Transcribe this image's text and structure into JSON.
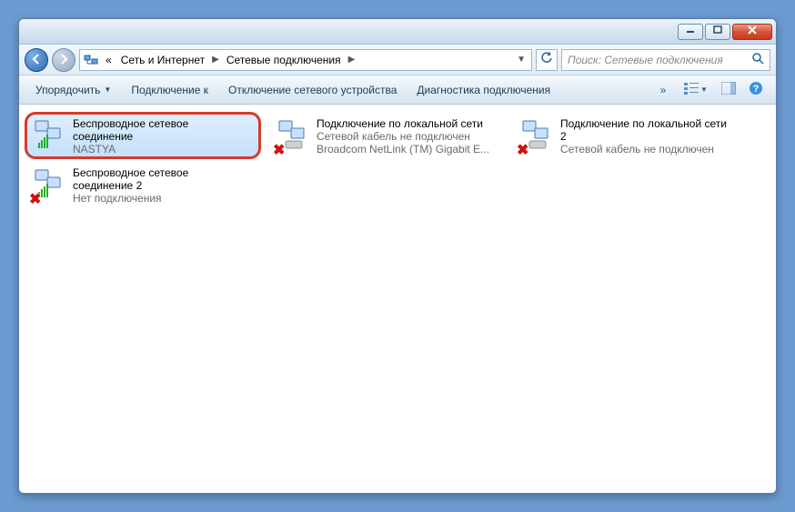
{
  "titlebar": {
    "min_icon": "minimize-icon",
    "max_icon": "maximize-icon",
    "close_icon": "close-icon"
  },
  "nav": {
    "back_icon": "back-arrow-icon",
    "forward_icon": "forward-arrow-icon",
    "refresh_icon": "refresh-icon"
  },
  "breadcrumb": {
    "prefix": "«",
    "seg1": "Сеть и Интернет",
    "seg2": "Сетевые подключения"
  },
  "search": {
    "placeholder": "Поиск: Сетевые подключения",
    "icon": "search-icon"
  },
  "toolbar": {
    "organize": "Упорядочить",
    "connect_to": "Подключение к",
    "disable_device": "Отключение сетевого устройства",
    "diagnose": "Диагностика подключения",
    "more_icon": "chevron-right-icon",
    "view_icon": "view-options-icon",
    "preview_icon": "preview-pane-icon",
    "help_icon": "help-icon"
  },
  "connections": [
    {
      "title": "Беспроводное сетевое",
      "title2": "соединение",
      "status": "NASTYA",
      "detail": "",
      "icon": "wifi-icon",
      "selected": true,
      "highlight": true,
      "disabled": false
    },
    {
      "title": "Подключение по локальной сети",
      "title2": "",
      "status": "Сетевой кабель не подключен",
      "detail": "Broadcom NetLink (TM) Gigabit E...",
      "icon": "ethernet-icon",
      "selected": false,
      "highlight": false,
      "disabled": true
    },
    {
      "title": "Подключение по локальной сети",
      "title2": "2",
      "status": "Сетевой кабель не подключен",
      "detail": "",
      "icon": "ethernet-icon",
      "selected": false,
      "highlight": false,
      "disabled": true
    },
    {
      "title": "Беспроводное сетевое",
      "title2": "соединение 2",
      "status": "Нет подключения",
      "detail": "",
      "icon": "wifi-icon",
      "selected": false,
      "highlight": false,
      "disabled": true
    }
  ]
}
